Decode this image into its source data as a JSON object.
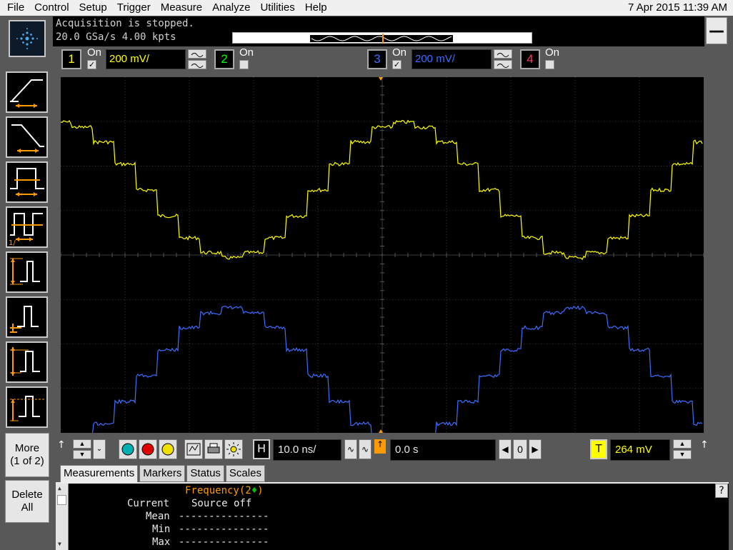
{
  "menu": {
    "items": [
      "File",
      "Control",
      "Setup",
      "Trigger",
      "Measure",
      "Analyze",
      "Utilities",
      "Help"
    ],
    "clock": "7 Apr 2015 11:39 AM"
  },
  "acquisition": {
    "status": "Acquisition is stopped.",
    "rate": "20.0 GSa/s   4.00 kpts"
  },
  "minimize_label": "—",
  "channels": [
    {
      "num": "1",
      "on_label": "On",
      "checked": true,
      "scale": "200 mV/",
      "color": "#ffff00"
    },
    {
      "num": "2",
      "on_label": "On",
      "checked": false,
      "color": "#00ff00"
    },
    {
      "num": "3",
      "on_label": "On",
      "checked": true,
      "scale": "200 mV/",
      "color": "#3c6eff"
    },
    {
      "num": "4",
      "on_label": "On",
      "checked": false,
      "color": "#ff3c64"
    }
  ],
  "markers": {
    "trigger": "T",
    "ch1": "1",
    "ch3": "3"
  },
  "sidebar": {
    "more_label": "More",
    "more_page": "(1 of 2)",
    "delete_label": "Delete",
    "delete_sub": "All"
  },
  "horizontal": {
    "h_label": "H",
    "timebase": "10.0 ns/",
    "delay": "0.0 s",
    "ref": "0",
    "t_label": "T",
    "trigger_level": "264 mV"
  },
  "tabs": [
    "Measurements",
    "Markers",
    "Status",
    "Scales"
  ],
  "measurements": {
    "title": "Frequency(2",
    "title_suffix": ")",
    "title_marker": "♦",
    "current_label": "Current",
    "current_value": "Source off",
    "mean_label": "Mean",
    "min_label": "Min",
    "max_label": "Max",
    "dashes": "---------------"
  },
  "help_label": "?"
}
